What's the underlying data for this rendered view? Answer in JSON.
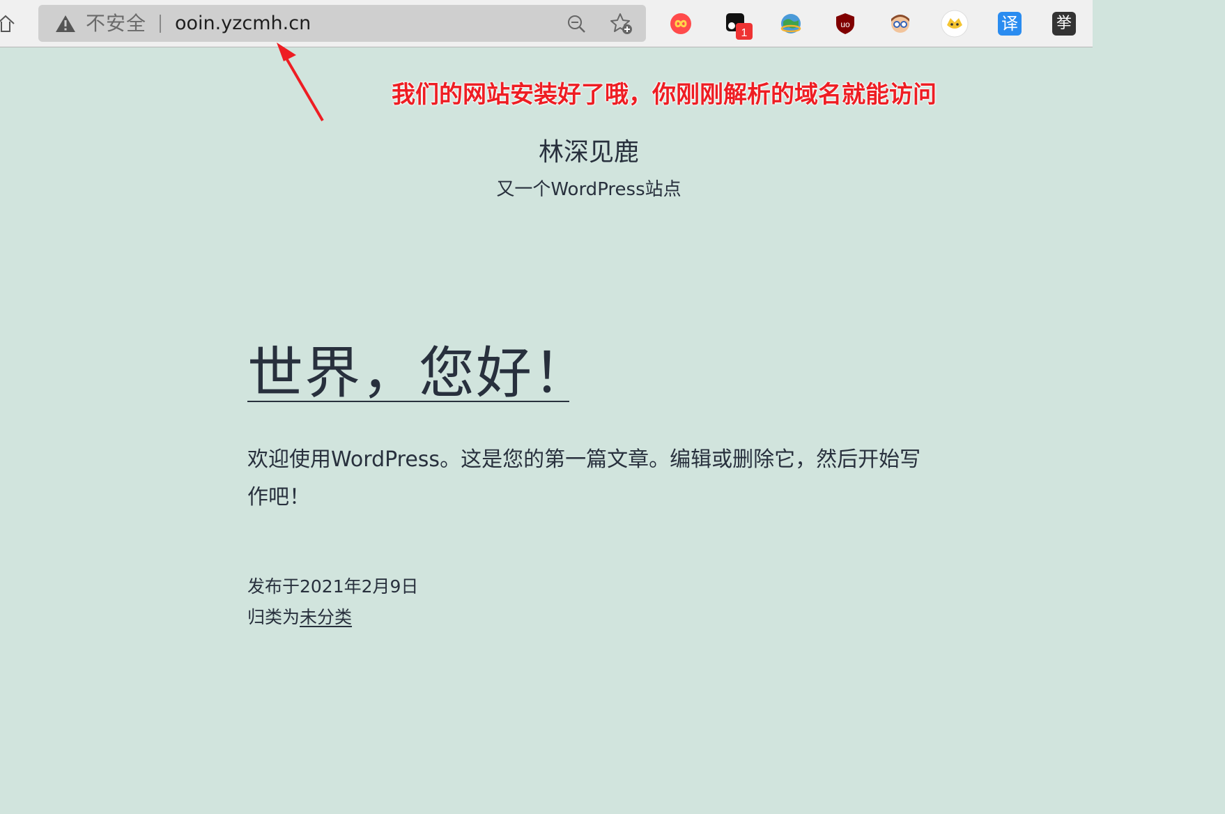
{
  "browser": {
    "security_label": "不安全",
    "url": "ooin.yzcmh.cn",
    "extensions": [
      {
        "name": "infinity-extension-icon",
        "color": "#ff4b4b"
      },
      {
        "name": "badge-extension-icon",
        "badge": "1",
        "color": "#111111"
      },
      {
        "name": "globe-extension-icon",
        "color": "#2e7d32"
      },
      {
        "name": "ublock-extension-icon",
        "color": "#800000",
        "glyph": "uo"
      },
      {
        "name": "avatar-extension-icon",
        "color": "#e9a777"
      },
      {
        "name": "tampermonkey-extension-icon",
        "color": "#f4c431"
      },
      {
        "name": "translate-extension-icon",
        "color": "#2a8cf0",
        "glyph": "译"
      },
      {
        "name": "dark-extension-icon",
        "color": "#333333",
        "glyph": "挙"
      }
    ]
  },
  "annotation": "我们的网站安装好了哦，你刚刚解析的域名就能访问",
  "site": {
    "title": "林深见鹿",
    "description": "又一个WordPress站点"
  },
  "post": {
    "title": "世界，您好！",
    "body": "欢迎使用WordPress。这是您的第一篇文章。编辑或删除它，然后开始写作吧！",
    "date_label": "发布于2021年2月9日",
    "category_prefix": "归类为",
    "category": "未分类"
  }
}
